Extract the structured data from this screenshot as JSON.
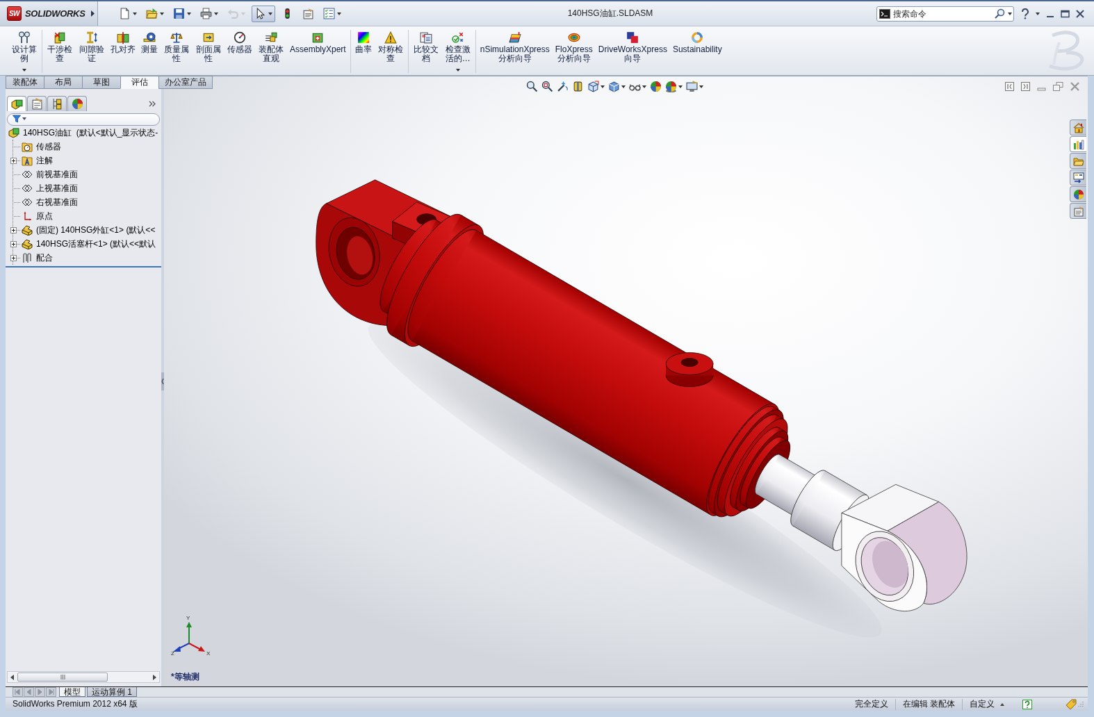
{
  "title_bar": {
    "logo": {
      "mark": "SW",
      "wordmark": "SOLIDWORKS"
    },
    "quick_access": [
      {
        "dropdown": true,
        "selected": false,
        "disabled": false
      },
      {
        "dropdown": true,
        "selected": false,
        "disabled": false
      },
      {
        "dropdown": true,
        "selected": false,
        "disabled": false
      },
      {
        "dropdown": true,
        "selected": false,
        "disabled": false
      },
      {
        "dropdown": true,
        "selected": false,
        "disabled": true
      },
      {
        "dropdown": true,
        "selected": true,
        "disabled": false
      },
      {
        "dropdown": false,
        "selected": false,
        "disabled": false
      },
      {
        "dropdown": false,
        "selected": false,
        "disabled": false
      },
      {
        "dropdown": true,
        "selected": false,
        "disabled": false
      }
    ],
    "title": "140HSG油缸.SLDASM",
    "search": {
      "placeholder": "搜索命令"
    }
  },
  "ribbon": {
    "groups": [
      {
        "buttons": [
          {
            "label": "设计算例",
            "dropdown": true
          }
        ]
      },
      {
        "buttons": [
          {
            "label": "干涉检查",
            "dropdown": false
          },
          {
            "label": "间隙验证",
            "dropdown": false
          },
          {
            "label": "孔对齐",
            "dropdown": false
          },
          {
            "label": "测量",
            "dropdown": false
          },
          {
            "label": "质量属性",
            "dropdown": false
          },
          {
            "label": "剖面属性",
            "dropdown": false
          },
          {
            "label": "传感器",
            "dropdown": false
          },
          {
            "label": "装配体直观",
            "dropdown": false
          },
          {
            "label": "AssemblyXpert",
            "dropdown": false
          }
        ]
      },
      {
        "buttons": [
          {
            "label": "曲率",
            "dropdown": false
          },
          {
            "label": "对称检查",
            "dropdown": false
          }
        ]
      },
      {
        "buttons": [
          {
            "label": "比较文档",
            "dropdown": false
          },
          {
            "label": "检查激活的…",
            "dropdown": true
          }
        ]
      },
      {
        "buttons": [
          {
            "label": "nSimulationXpress分析向导",
            "dropdown": false
          },
          {
            "label": "FloXpress分析向导",
            "dropdown": false
          },
          {
            "label": "DriveWorksXpress向导",
            "dropdown": false
          },
          {
            "label": "Sustainability",
            "dropdown": false
          }
        ]
      }
    ]
  },
  "command_tabs": [
    {
      "label": "装配体",
      "selected": false
    },
    {
      "label": "布局",
      "selected": false
    },
    {
      "label": "草图",
      "selected": false
    },
    {
      "label": "评估",
      "selected": true
    },
    {
      "label": "办公室产品",
      "selected": false
    }
  ],
  "feature_manager": {
    "panel_tabs": [
      {
        "selected": true
      },
      {
        "selected": false
      },
      {
        "selected": false
      },
      {
        "selected": false
      }
    ],
    "tree": [
      {
        "label": "140HSG油缸  (默认<默认_显示状态-",
        "kind": "assembly",
        "children": [
          {
            "label": "传感器",
            "kind": "sensor-folder",
            "expandable": false
          },
          {
            "label": "注解",
            "kind": "annotation-folder",
            "expandable": true
          },
          {
            "label": "前视基准面",
            "kind": "plane",
            "expandable": false
          },
          {
            "label": "上视基准面",
            "kind": "plane",
            "expandable": false
          },
          {
            "label": "右视基准面",
            "kind": "plane",
            "expandable": false
          },
          {
            "label": "原点",
            "kind": "origin",
            "expandable": false
          },
          {
            "label": "(固定) 140HSG外缸<1> (默认<<",
            "kind": "part",
            "expandable": true
          },
          {
            "label": "140HSG活塞杆<1> (默认<<默认",
            "kind": "part",
            "expandable": true
          },
          {
            "label": "配合",
            "kind": "mates",
            "expandable": true
          }
        ]
      }
    ]
  },
  "graphics_area": {
    "view_name": "*等轴测",
    "triad_axes": [
      "Y",
      "X",
      "Z"
    ]
  },
  "task_pane_tabs": [
    {
      "selected": false
    },
    {
      "selected": true
    },
    {
      "selected": false
    },
    {
      "selected": false
    },
    {
      "selected": false
    },
    {
      "selected": false
    }
  ],
  "bottom_tabs": [
    {
      "label": "模型",
      "selected": true
    },
    {
      "label": "运动算例 1",
      "selected": false
    }
  ],
  "status_bar": {
    "product": "SolidWorks Premium 2012 x64 版",
    "fields": [
      "完全定义",
      "在编辑 装配体",
      "自定义"
    ]
  }
}
